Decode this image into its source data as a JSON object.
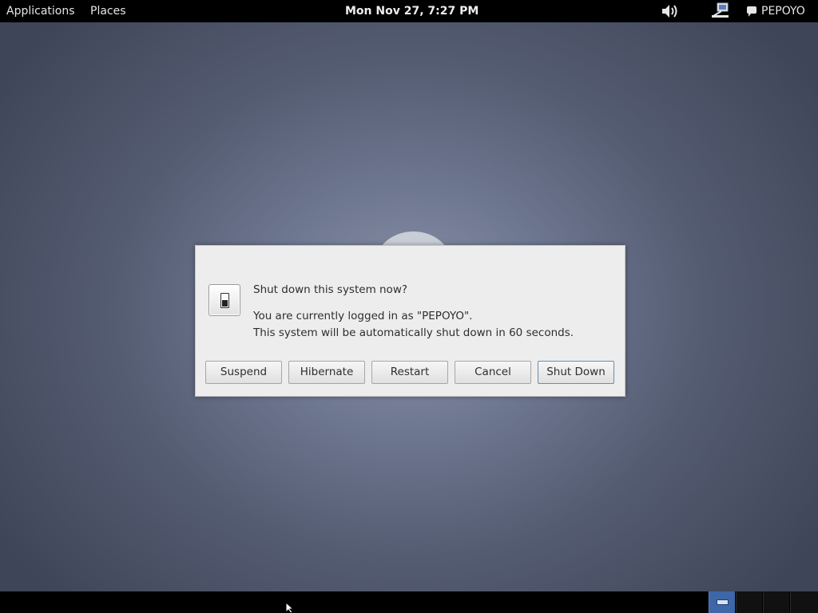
{
  "top_panel": {
    "applications": "Applications",
    "places": "Places",
    "clock": "Mon Nov 27,  7:27 PM",
    "volume_icon": "speaker-volume-icon",
    "network_icon": "network-wired-icon",
    "user_icon": "chat-bubble-icon",
    "user_name": "PEPOYO"
  },
  "dialog": {
    "icon": "power-switch-icon",
    "heading": "Shut down this system now?",
    "line1": "You are currently logged in as \"PEPOYO\".",
    "line2": "This system will be automatically shut down in 60 seconds.",
    "buttons": {
      "suspend": "Suspend",
      "hibernate": "Hibernate",
      "restart": "Restart",
      "cancel": "Cancel",
      "shutdown": "Shut Down"
    }
  },
  "bottom_panel": {
    "workspaces": [
      "workspace-1",
      "workspace-2",
      "workspace-3",
      "workspace-4"
    ],
    "active_workspace": 1
  },
  "colors": {
    "panel": "#000000",
    "dialog_bg": "#ededed",
    "active_workspace": "#3d67a8",
    "default_button_border": "#6a8cb0"
  }
}
